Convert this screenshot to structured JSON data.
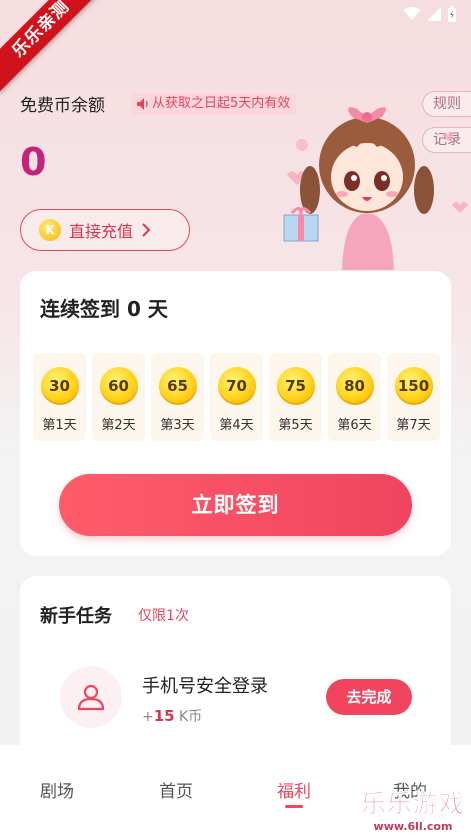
{
  "ribbon": "乐乐亲测",
  "header": {
    "balance_label": "免费币余额",
    "validity_note": "从获取之日起5天内有效",
    "balance_value": "0",
    "rules_label": "规则",
    "records_label": "记录",
    "recharge_label": "直接充值",
    "coin_letter": "K"
  },
  "checkin": {
    "title": "连续签到 0 天",
    "days": [
      {
        "amount": "30",
        "label": "第1天"
      },
      {
        "amount": "60",
        "label": "第2天"
      },
      {
        "amount": "65",
        "label": "第3天"
      },
      {
        "amount": "70",
        "label": "第4天"
      },
      {
        "amount": "75",
        "label": "第5天"
      },
      {
        "amount": "80",
        "label": "第6天"
      },
      {
        "amount": "150",
        "label": "第7天"
      }
    ],
    "button_label": "立即签到"
  },
  "tasks": {
    "title": "新手任务",
    "limit": "仅限1次",
    "items": [
      {
        "name": "手机号安全登录",
        "reward_prefix": "+",
        "reward_amount": "15",
        "reward_unit": " K币",
        "button_label": "去完成"
      }
    ]
  },
  "tabbar": {
    "items": [
      {
        "label": "剧场"
      },
      {
        "label": "首页"
      },
      {
        "label": "福利"
      },
      {
        "label": "我的"
      }
    ],
    "active_index": 2
  },
  "watermark": {
    "main": "乐乐游戏",
    "url": "www.6ll.com"
  },
  "colors": {
    "accent": "#f0445f",
    "balance": "#c4237a",
    "coin": "#ffd21a"
  }
}
